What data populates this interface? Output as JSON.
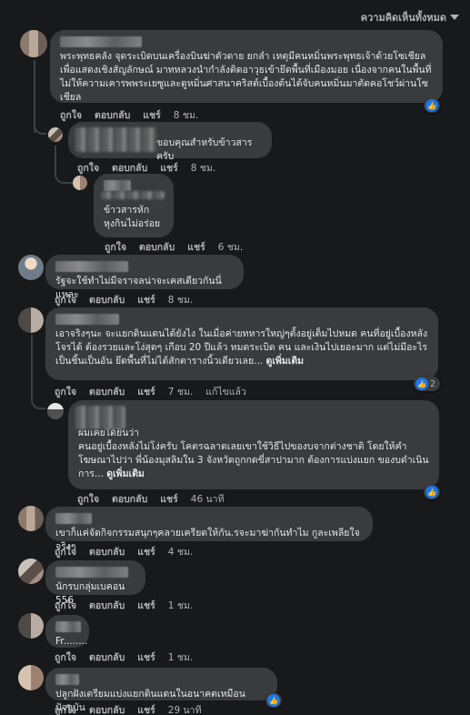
{
  "filter": {
    "label": "ความคิดเห็นทั้งหมด"
  },
  "actions": {
    "like": "ถูกใจ",
    "reply": "ตอบกลับ",
    "share": "แชร์",
    "edited": "แก้ไขแล้ว"
  },
  "comments": [
    {
      "text": "พระพุทธคลัง จุดระเบิดบนเครื่องบินฆ่าตัวตาย ยกลำ เหตุมีคนหมิ่นพระพุทธเจ้าด้วยโซเชียล เพื่อแสดงเชิงสัญลักษณ์ มาทหลวงนำกำลังติดอาวุธเข้ายึดพื้นที่เมืองมอย เนื่องจากคนในพื้นที่ไม่ให้ความเคารพพระเยซูและดูหมิ่นศาสนาคริสต์เบื้องต้นได้จับคนหมิ่นมาตัดคอโชว์ผ่านโซเชียล",
      "time": "8 ชม."
    },
    {
      "text": "ขอบคุณสำหรับข้าวสารครับ",
      "time": "8 ชม."
    },
    {
      "text_line1": "ข้าวสารหัก",
      "text_line2": "หุงกินไม่อร่อย",
      "time": "6 ชม."
    },
    {
      "text": "รัฐจะใช้ทำไม่มีจราจลน่าจะเคสเดียวกันนี่แหละ",
      "time": "8 ชม."
    },
    {
      "text": "เอาจริงๆนะ จะแยกดินแดนได้ยังไง ในเมื่อค่ายทหารใหญ่ๆตั้งอยู่เต็มไปหมด คนที่อยู่เบื้องหลังโจรได้ ต้องรวยและโง่สุดๆ เกือบ 20 ปีแล้ว หมดระเบิด คน และเงินไปเยอะมาก แต่ไม่มีอะไรเป็นชิ้นเป็นอัน ยึดพื้นที่ไม่ได้สักตารางนิ้วเดียวเลย...",
      "more": "ดูเพิ่มเติม",
      "time": "7 ชม.",
      "reactions": "2"
    },
    {
      "text_line1": "ผมเคยได้ยินว่า",
      "text": "คนอยู่เบื้องหลังไม่โง่ครับ โคตรฉลาดเลยเขาใช้วิธีไปของบจากต่างชาติ โดยให้คำโฆษณาไปว่า พี่น้องมุสลิมใน 3 จังหวัดถูกกดขี่สาปามาก ต้องการแบ่งแยก ของบดำเนินการ...",
      "more": "ดูเพิ่มเติม",
      "time": "46 นาที"
    },
    {
      "text": "เขาก็แค่จัดกิจกรรมสนุกๆคลายเครียดให้กัน.รจะมาฆ่ากันทำไม กูละเพลียใจจริงๆ",
      "time": "4 ชม."
    },
    {
      "text": "นักรบกลุ่มเบคอน 556",
      "time": "1 ชม."
    },
    {
      "text": "Fr........",
      "time": "1 ชม."
    },
    {
      "text": "ปลูกฝังเตรียมแบ่งแยกดินแดนในอนาคตเหมือนปัจจุบัน",
      "time": "29 นาที"
    }
  ]
}
